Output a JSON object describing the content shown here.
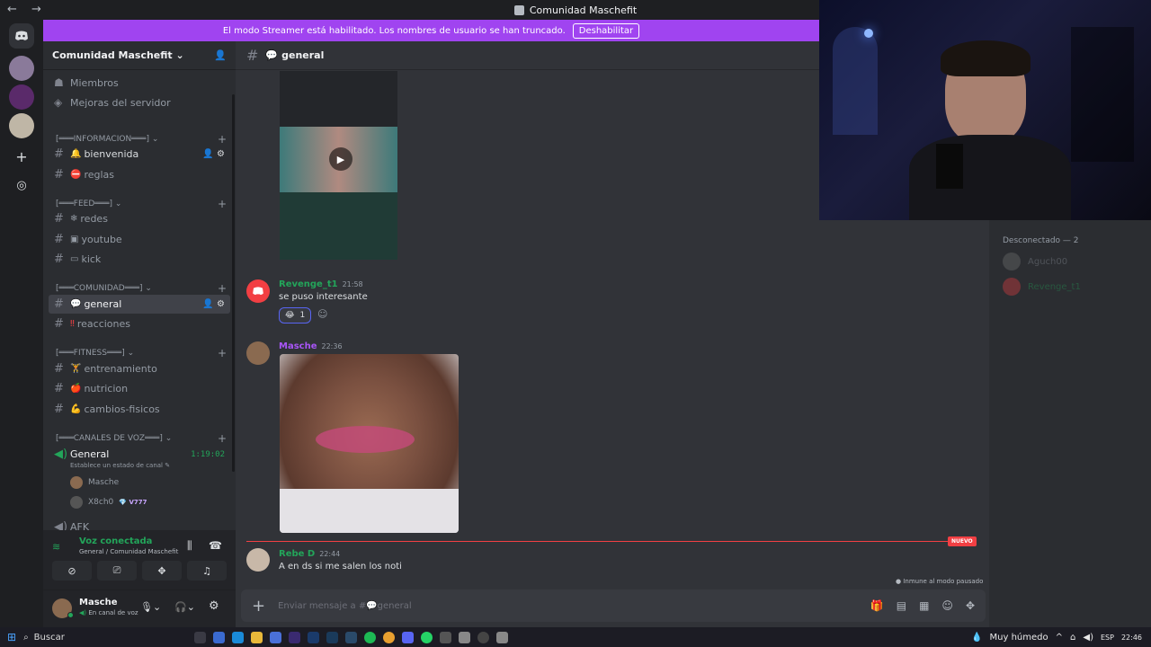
{
  "window": {
    "title": "Comunidad Maschefit",
    "nav": "← →"
  },
  "banner": {
    "text": "El modo Streamer está habilitado. Los nombres de usuario se han truncado.",
    "button": "Deshabilitar"
  },
  "server": {
    "name": "Comunidad Maschefit ⌄"
  },
  "sidebar": {
    "members_label": "Miembros",
    "boosts_label": "Mejoras del servidor",
    "categories": {
      "informacion": "[═══INFORMACION═══]",
      "feed": "[═══FEED═══]",
      "comunidad": "[═══COMUNIDAD═══]",
      "fitness": "[═══FITNESS═══]",
      "voz": "[═══CANALES DE VOZ═══]"
    },
    "channels": {
      "bienvenida": "bienvenida",
      "reglas": "reglas",
      "redes": "redes",
      "youtube": "youtube",
      "kick": "kick",
      "general": "general",
      "reacciones": "reacciones",
      "entrenamiento": "entrenamiento",
      "nutricion": "nutricion",
      "cambios": "cambios-fisicos"
    },
    "voice": {
      "channel": "General",
      "timer": "1:19:02",
      "status_hint": "Establece un estado de canal",
      "users": [
        "Masche",
        "X8ch0"
      ],
      "user2_badge": "V777",
      "afk": "AFK"
    }
  },
  "voice_panel": {
    "status": "Voz conectada",
    "location": "General / Comunidad Maschefit"
  },
  "user_panel": {
    "name": "Masche",
    "status": "En canal de voz"
  },
  "channel_header": {
    "name": "general"
  },
  "messages": [
    {
      "author": "Revenge_t1",
      "time": "21:58",
      "text": "se puso interesante",
      "reaction_count": "1"
    },
    {
      "author": "Masche",
      "time": "22:36"
    },
    {
      "author": "Rebe D",
      "time": "22:44",
      "text": "A en ds si me salen los noti"
    }
  ],
  "new_badge": "NUEVO",
  "paused_hint": "Inmune al modo pausado",
  "composer": {
    "placeholder": "Enviar mensaje a #💬general"
  },
  "members_panel": {
    "offline_header": "Desconectado — 2",
    "members": [
      "Aguch00",
      "Revenge_t1"
    ]
  },
  "taskbar": {
    "search": "Buscar",
    "weather": "Muy húmedo",
    "lang": "ESP",
    "time": "22:46"
  },
  "colors": {
    "accent": "#a044f0",
    "green": "#23a55a",
    "purple_name": "#a855f7",
    "red": "#f23f43"
  }
}
